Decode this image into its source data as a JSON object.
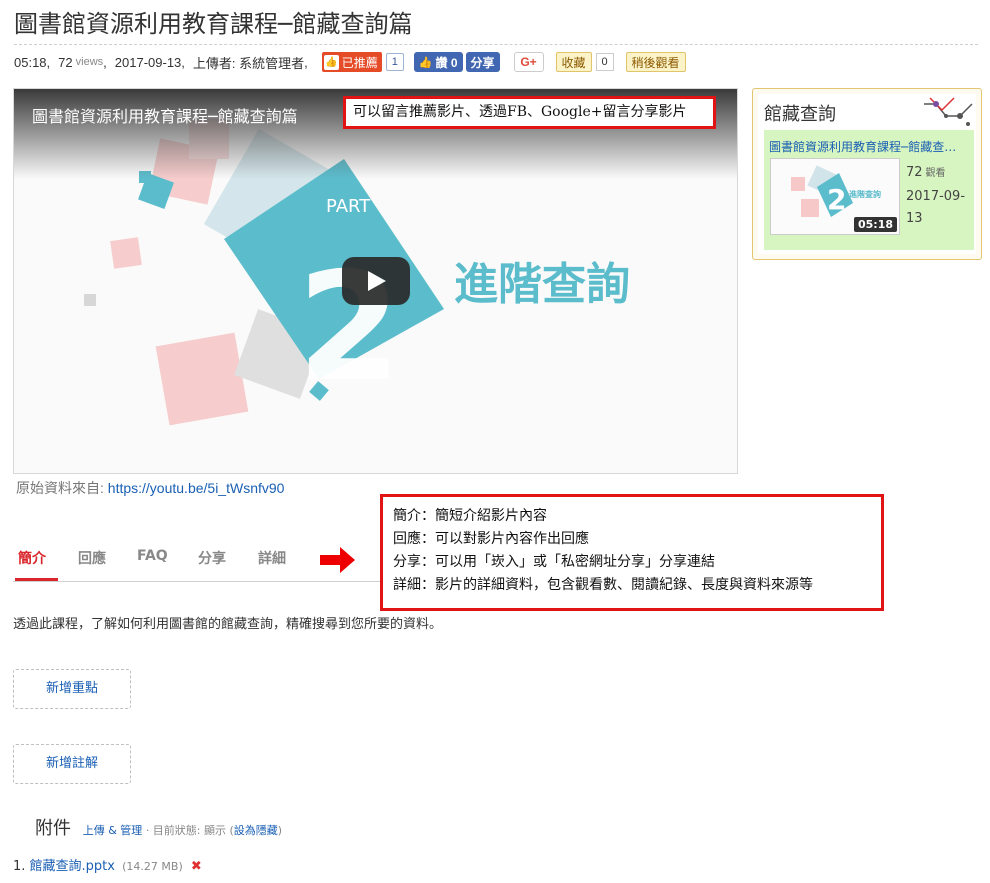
{
  "page": {
    "title": "圖書館資源利用教育課程─館藏查詢篇"
  },
  "meta": {
    "duration": "05:18",
    "views": "72",
    "views_unit": "views",
    "date": "2017-09-13",
    "uploader": "上傳者: 系統管理者",
    "recommend_label": "已推薦",
    "recommend_count": "1",
    "fb_like_label": "讚 0",
    "fb_share_label": "分享",
    "gplus_label": "G+",
    "collect_label": "收藏",
    "collect_count": "0",
    "watch_later_label": "稍後觀看"
  },
  "player": {
    "video_title": "圖書館資源利用教育課程─館藏查詢篇",
    "art_part_text": "PART",
    "art_number": "2",
    "art_caption": "進階查詢",
    "play_icon": "play-icon"
  },
  "callouts": {
    "top": "可以留言推薦影片、透過FB、Google+留言分享影片",
    "box_lines": [
      "簡介：簡短介紹影片內容",
      "回應：可以對影片內容作出回應",
      "分享：可以用「崁入」或「私密網址分享」分享連結",
      "詳細：影片的詳細資料，包含觀看數、閱讀紀錄、長度與資料來源等"
    ]
  },
  "sidebar": {
    "title": "館藏查詢",
    "card": {
      "title": "圖書館資源利用教育課程─館藏查詢篇",
      "duration": "05:18",
      "views": "72",
      "views_unit": "觀看",
      "date": "2017-09-13"
    }
  },
  "source": {
    "label": "原始資料來自:",
    "url": "https://youtu.be/5i_tWsnfv90"
  },
  "tabs": [
    {
      "label": "簡介",
      "active": true
    },
    {
      "label": "回應",
      "active": false
    },
    {
      "label": "FAQ",
      "active": false
    },
    {
      "label": "分享",
      "active": false
    },
    {
      "label": "詳細",
      "active": false
    }
  ],
  "intro": "透過此課程，了解如何利用圖書館的館藏查詢，精確搜尋到您所要的資料。",
  "buttons": {
    "add_highlight": "新增重點",
    "add_note": "新增註解"
  },
  "attachments": {
    "title": "附件",
    "manage_link": "上傳 & 管理",
    "status_text": "· 目前狀態: 顯示 (",
    "hide_link": "設為隱藏",
    "status_close": ")",
    "items": [
      {
        "index": "1.",
        "name": "館藏查詢.pptx",
        "size": "(14.27 MB)"
      }
    ]
  },
  "colors": {
    "accent_red": "#d9262c",
    "callout_red": "#e01414",
    "link_blue": "#1a5fb4",
    "fb_blue": "#4267b2",
    "sidebar_card_green": "#d7f5c0",
    "art_teal": "#5bbccc"
  }
}
